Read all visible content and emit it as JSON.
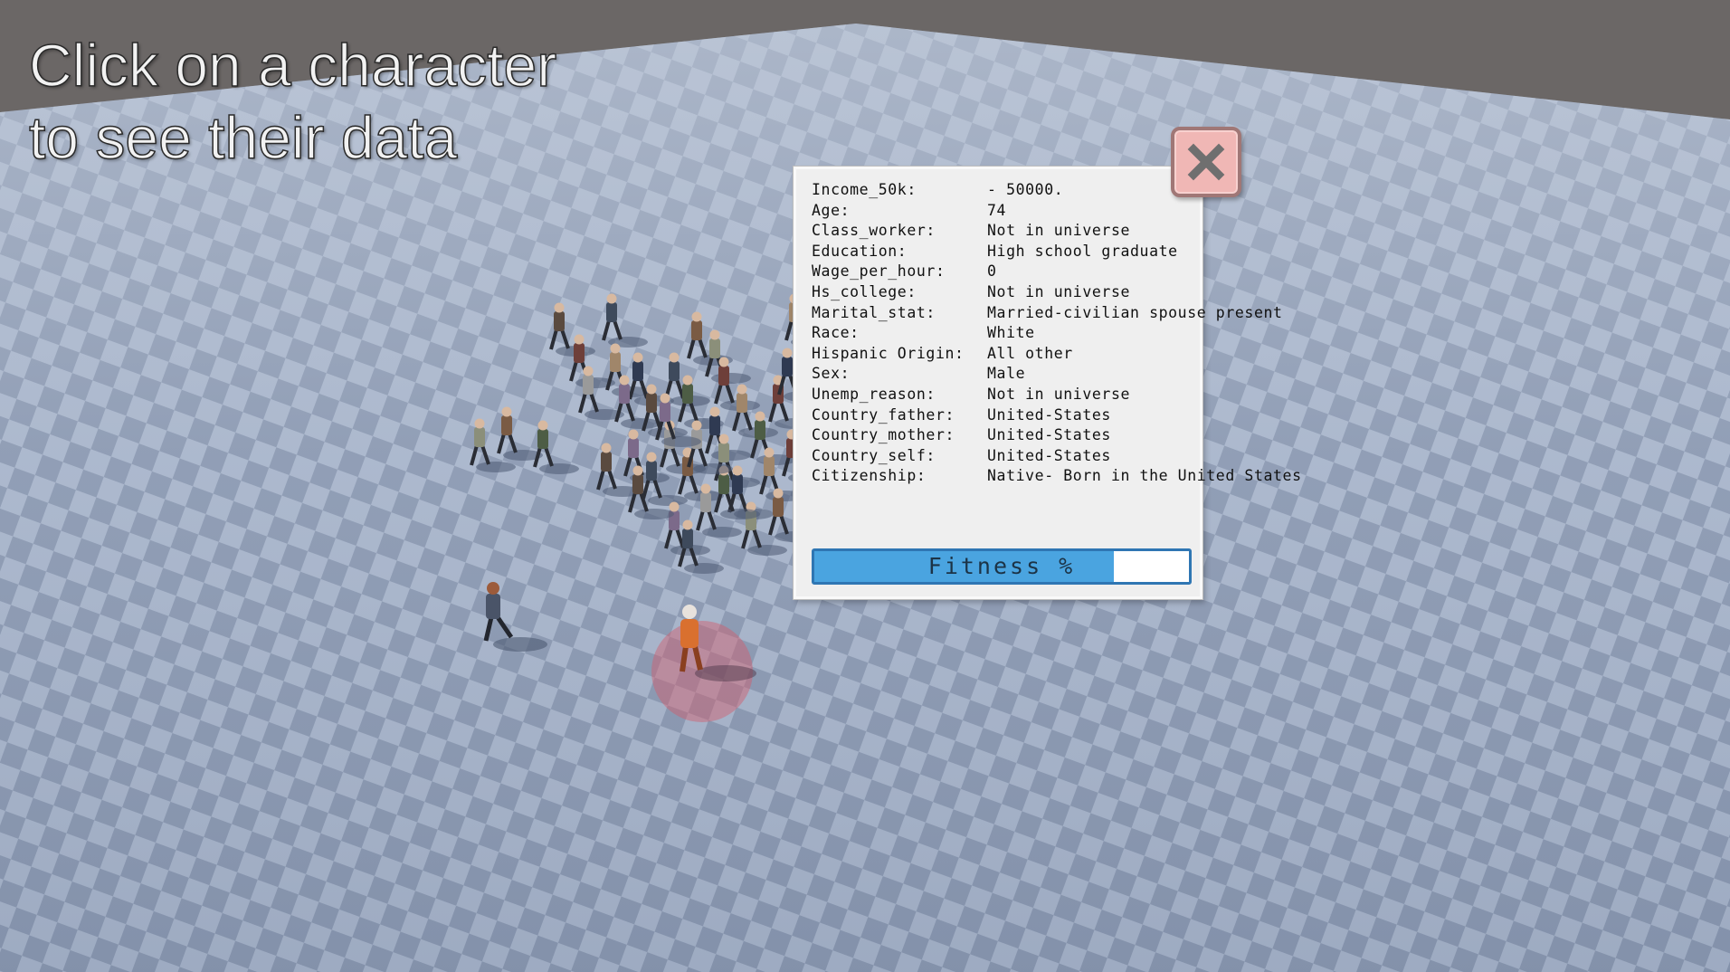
{
  "instructions": "Click on a character\nto see their data",
  "close_icon": "close-x-icon",
  "character_data": {
    "rows": [
      {
        "label": "Income_50k:",
        "value": "- 50000."
      },
      {
        "label": "Age:",
        "value": "74"
      },
      {
        "label": "Class_worker:",
        "value": "Not in universe"
      },
      {
        "label": "Education:",
        "value": "High school graduate"
      },
      {
        "label": "Wage_per_hour:",
        "value": "0"
      },
      {
        "label": "Hs_college:",
        "value": "Not in universe"
      },
      {
        "label": "Marital_stat:",
        "value": "Married-civilian spouse present"
      },
      {
        "label": "Race:",
        "value": "White"
      },
      {
        "label": "Hispanic Origin:",
        "value": "All other"
      },
      {
        "label": "Sex:",
        "value": "Male"
      },
      {
        "label": "Unemp_reason:",
        "value": "Not in universe"
      },
      {
        "label": "Country_father:",
        "value": "United-States"
      },
      {
        "label": "Country_mother:",
        "value": "United-States"
      },
      {
        "label": "Country_self:",
        "value": "United-States"
      },
      {
        "label": "Citizenship:",
        "value": "Native- Born in the United States"
      }
    ]
  },
  "fitness": {
    "label": "Fitness %",
    "percent": 80
  },
  "colors": {
    "sky": "#6b6766",
    "floor_light": "#a9b6cc",
    "floor_dark": "#7f8da7",
    "selection_ring": "#d25a6a",
    "fitness_fill": "#4aa4e0",
    "fitness_border": "#2f76b3",
    "close_button": "#f0b7b5"
  }
}
